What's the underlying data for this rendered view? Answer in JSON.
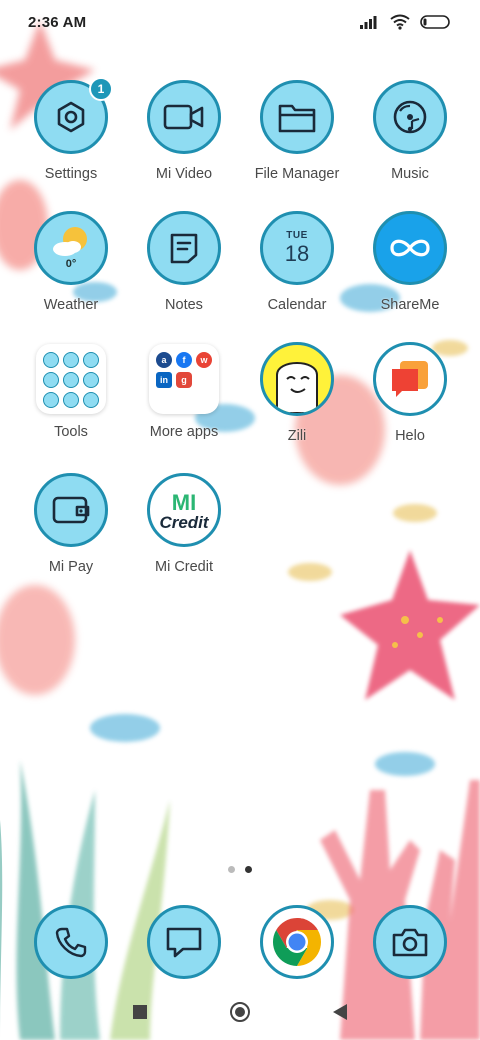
{
  "status": {
    "time": "2:36 AM"
  },
  "apps": [
    {
      "label": "Settings",
      "icon": "settings-hexagon-icon",
      "badge": "1"
    },
    {
      "label": "Mi Video",
      "icon": "video-camera-icon"
    },
    {
      "label": "File Manager",
      "icon": "folder-icon"
    },
    {
      "label": "Music",
      "icon": "music-disc-icon"
    },
    {
      "label": "Weather",
      "icon": "weather-sun-cloud-icon",
      "temp": "0°"
    },
    {
      "label": "Notes",
      "icon": "notes-icon"
    },
    {
      "label": "Calendar",
      "icon": "calendar-icon",
      "month": "TUE",
      "day": "18"
    },
    {
      "label": "ShareMe",
      "icon": "shareme-infinity-icon"
    },
    {
      "label": "Tools",
      "icon": "tools-folder-icon"
    },
    {
      "label": "More apps",
      "icon": "more-apps-folder-icon"
    },
    {
      "label": "Zili",
      "icon": "zili-face-icon"
    },
    {
      "label": "Helo",
      "icon": "helo-chat-icon"
    },
    {
      "label": "Mi Pay",
      "icon": "wallet-icon"
    },
    {
      "label": "Mi Credit",
      "icon": "mi-credit-icon",
      "logo_top": "MI",
      "logo_bottom": "Credit"
    }
  ],
  "dock": [
    {
      "icon": "phone-icon"
    },
    {
      "icon": "message-icon"
    },
    {
      "icon": "chrome-icon"
    },
    {
      "icon": "camera-icon"
    }
  ],
  "page_indicator": {
    "count": 2,
    "active": 2
  },
  "colors": {
    "icon_fill": "#8fdcf2",
    "icon_border": "#1f8fb0",
    "badge": "#1e97b8"
  }
}
